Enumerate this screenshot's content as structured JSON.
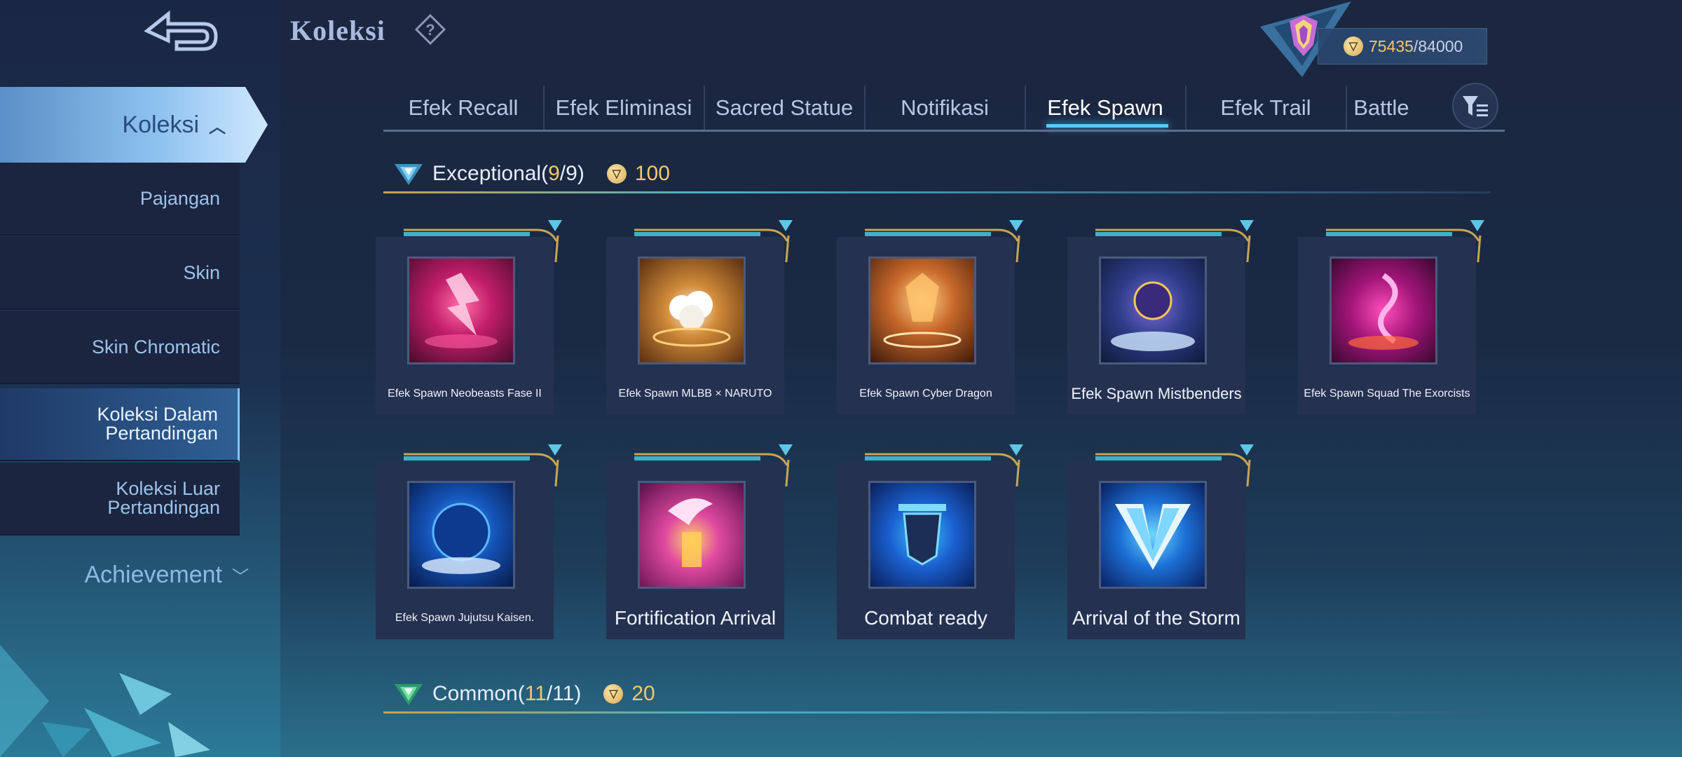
{
  "header": {
    "title": "Koleksi",
    "points_current": "75435",
    "points_max": "84000",
    "points_separator": "/"
  },
  "sidebar": {
    "main_label": "Koleksi",
    "items": [
      {
        "label": "Pajangan"
      },
      {
        "label": "Skin"
      },
      {
        "label": "Skin Chromatic"
      },
      {
        "label": "Koleksi Dalam Pertandingan",
        "active": true
      },
      {
        "label": "Koleksi Luar Pertandingan"
      }
    ],
    "achievement_label": "Achievement"
  },
  "tabs": [
    {
      "label": "Efek Recall"
    },
    {
      "label": "Efek Eliminasi"
    },
    {
      "label": "Sacred Statue"
    },
    {
      "label": "Notifikasi"
    },
    {
      "label": "Efek Spawn",
      "active": true
    },
    {
      "label": "Efek Trail"
    },
    {
      "label": "Battle"
    }
  ],
  "sections": [
    {
      "name": "Exceptional",
      "count": "9",
      "total": "9",
      "reward": "100",
      "items": [
        {
          "label": "Efek Spawn Neobeasts Fase II"
        },
        {
          "label": "Efek Spawn MLBB × NARUTO"
        },
        {
          "label": "Efek Spawn Cyber Dragon"
        },
        {
          "label": "Efek Spawn Mistbenders"
        },
        {
          "label": "Efek Spawn Squad The Exorcists"
        },
        {
          "label": "Efek Spawn Jujutsu Kaisen."
        },
        {
          "label": "Fortification Arrival"
        },
        {
          "label": "Combat ready"
        },
        {
          "label": "Arrival of the Storm"
        }
      ]
    },
    {
      "name": "Common",
      "count": "11",
      "total": "11",
      "reward": "20",
      "items": []
    }
  ],
  "colors": {
    "accent_cyan": "#5cc7ff",
    "gold": "#f2c86d",
    "card_bg": "#243150"
  },
  "icons": {
    "back": "back-arrow-icon",
    "help": "question-mark-icon",
    "filter": "filter-icon",
    "coin": "battle-point-coin-icon"
  }
}
